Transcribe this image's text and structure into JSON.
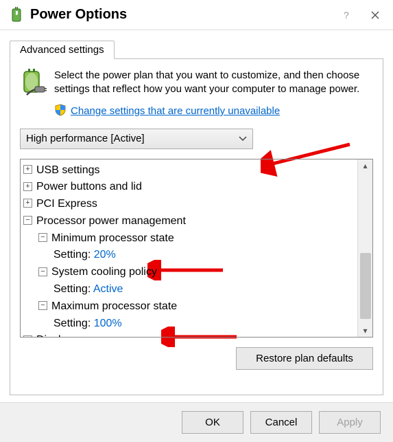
{
  "titlebar": {
    "title": "Power Options"
  },
  "tab": {
    "label": "Advanced settings"
  },
  "intro": {
    "text": "Select the power plan that you want to customize, and then choose settings that reflect how you want your computer to manage power."
  },
  "shieldlink": {
    "text": "Change settings that are currently unavailable"
  },
  "plan_dropdown": {
    "value": "High performance [Active]"
  },
  "tree": {
    "usb": {
      "label": "USB settings"
    },
    "pbl": {
      "label": "Power buttons and lid"
    },
    "pcie": {
      "label": "PCI Express"
    },
    "ppm": {
      "label": "Processor power management"
    },
    "min": {
      "label": "Minimum processor state",
      "setting_label": "Setting:",
      "value": "20%"
    },
    "cool": {
      "label": "System cooling policy",
      "setting_label": "Setting:",
      "value": "Active"
    },
    "max": {
      "label": "Maximum processor state",
      "setting_label": "Setting:",
      "value": "100%"
    },
    "disp": {
      "label": "Display"
    }
  },
  "restore": {
    "label": "Restore plan defaults"
  },
  "buttons": {
    "ok": "OK",
    "cancel": "Cancel",
    "apply": "Apply"
  }
}
